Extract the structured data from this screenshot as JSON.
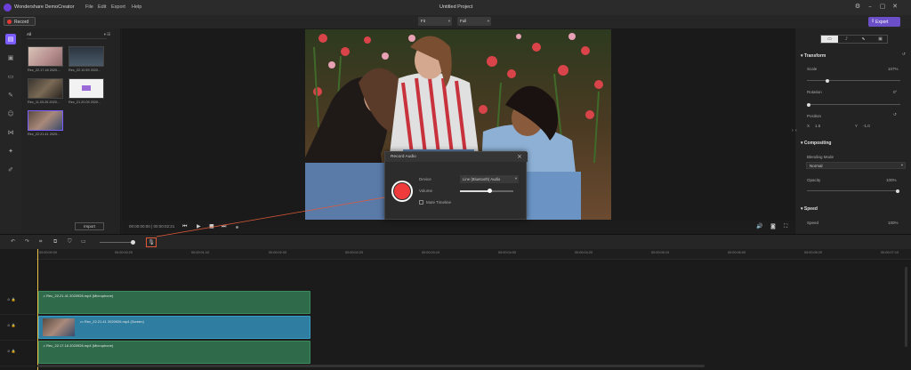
{
  "app": {
    "name": "Wondershare DemoCreator",
    "menu": [
      "File",
      "Edit",
      "Export",
      "Help"
    ],
    "project_title": "Untitled Project",
    "window_controls": [
      "⚙",
      "–",
      "▢",
      "✕"
    ]
  },
  "toolbar": {
    "record_label": "Record",
    "fit_label": "Fit",
    "full_label": "Full",
    "export_label": "Export"
  },
  "sidebar_icons": [
    "media-library-icon",
    "photo-icon",
    "caption-icon",
    "annotation-icon",
    "sticker-icon",
    "transition-icon",
    "effects-icon",
    "pen-icon"
  ],
  "media": {
    "filter_label": "All",
    "items": [
      {
        "label": "Rec_22.17.18 2020...."
      },
      {
        "label": "Rec_22.10.59 2020..."
      },
      {
        "label": "Rec_11.03.26 2020..."
      },
      {
        "label": "Rec_21.20.05 2020..."
      },
      {
        "label": "Rec_22.21.41 2020..."
      }
    ],
    "import_label": "Import"
  },
  "preview": {
    "timecode": "00:00:00:00 | 00:00:02:21"
  },
  "dialog": {
    "title": "Record Audio",
    "device_label": "Device",
    "device_value": "Line (Bluetooth) Audio",
    "volume_label": "Volume",
    "volume_level": 0.55,
    "mute_label": "Mute Timeline"
  },
  "props": {
    "transform_title": "Transform",
    "scale_label": "Scale",
    "scale_value": "107%",
    "rotation_label": "Rotation",
    "rotation_value": "0°",
    "position_label": "Position",
    "pos_x_label": "X",
    "pos_x_value": "1.5",
    "pos_y_label": "Y",
    "pos_y_value": "-1.0",
    "compositing_title": "Compositing",
    "blend_label": "Blending Mode",
    "blend_value": "Normal",
    "opacity_label": "Opacity",
    "opacity_value": "100%",
    "speed_title": "Speed",
    "speed_label": "Speed",
    "speed_value": "100%"
  },
  "timeline": {
    "ticks": [
      "00:00:00:00",
      "00:00:00:20",
      "00:00:01:10",
      "00:00:02:00",
      "00:00:02:20",
      "00:00:03:10",
      "00:00:04:00",
      "00:00:04:20",
      "00:00:05:10",
      "00:00:06:00",
      "00:00:06:20",
      "00:00:07:10",
      "00:00:08:00",
      "00:00:08:20"
    ],
    "clips": [
      {
        "label": "Rec_22.21.41 2020926.mp4 (Microphone)",
        "kind": "audio"
      },
      {
        "label": "Rec_22.21.41 2020926.mp4 (Screen)",
        "kind": "video"
      },
      {
        "label": "Rec_22.17.18 2020926.mp4 (Microphone)",
        "kind": "audio"
      }
    ]
  },
  "colors": {
    "accent": "#7b5cff",
    "record_red": "#ef3b3b",
    "audio_clip": "#2f6b4a",
    "video_clip": "#2f7ea1",
    "playhead": "#e8c14a"
  }
}
